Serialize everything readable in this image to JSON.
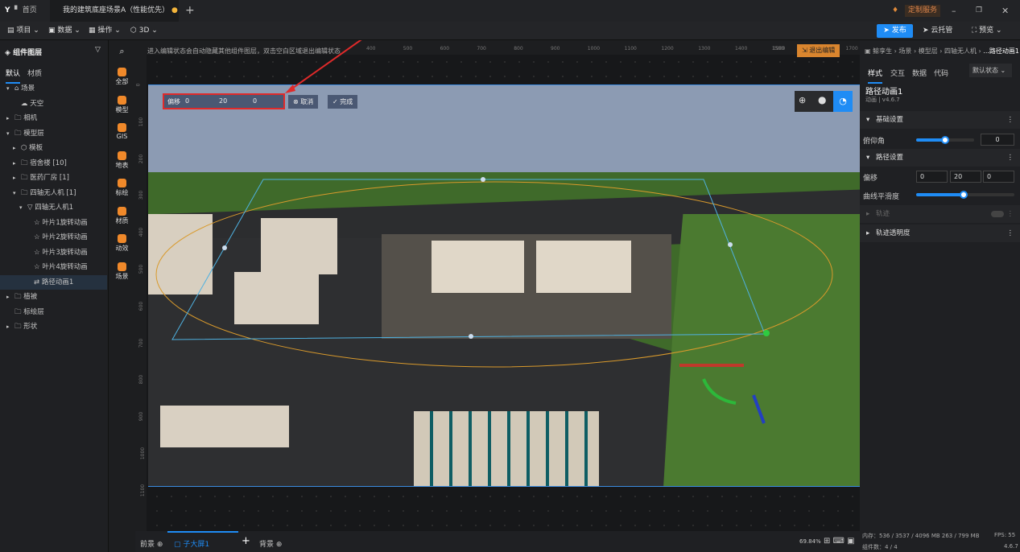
{
  "tabs": {
    "logo": "Y",
    "home": "首页",
    "active": "我的建筑底座场景A（性能优先）",
    "add": "+",
    "custom_service": "定制服务"
  },
  "toolbar": {
    "project": "项目",
    "data": "数据",
    "ops": "操作",
    "three_d": "3D",
    "publish": "发布",
    "cloud": "云托管",
    "preview": "预览"
  },
  "layers": {
    "title": "组件图层",
    "tabs": [
      "默认",
      "材质"
    ],
    "items": [
      {
        "label": "场景"
      },
      {
        "label": "天空"
      },
      {
        "label": "相机"
      },
      {
        "label": "模型层"
      },
      {
        "label": "模板"
      },
      {
        "label": "宿舍楼 [10]"
      },
      {
        "label": "医药厂房 [1]"
      },
      {
        "label": "四轴无人机 [1]"
      },
      {
        "label": "四轴无人机1"
      },
      {
        "label": "叶片1旋转动画"
      },
      {
        "label": "叶片2旋转动画"
      },
      {
        "label": "叶片3旋转动画"
      },
      {
        "label": "叶片4旋转动画"
      },
      {
        "label": "路径动画1"
      },
      {
        "label": "植被"
      },
      {
        "label": "标绘层"
      },
      {
        "label": "形状"
      }
    ]
  },
  "categories": [
    "全部",
    "模型",
    "GIS",
    "地表",
    "标绘",
    "材质",
    "动效",
    "场景"
  ],
  "canvas": {
    "hint": "进入编辑状态会自动隐藏其他组件图层，双击空白区域退出编辑状态",
    "exit_edit": "退出编辑",
    "ruler_top": [
      "400",
      "500",
      "600",
      "700",
      "800",
      "900",
      "1000",
      "1100",
      "1200",
      "1300",
      "1400",
      "1500",
      "1600",
      "1700",
      "1900"
    ],
    "ruler_left": [
      "0",
      "100",
      "200",
      "300",
      "400",
      "500",
      "600",
      "700",
      "800",
      "900",
      "1000",
      "1100"
    ],
    "offset_label": "偏移",
    "offset": [
      "0",
      "20",
      "0"
    ],
    "cancel": "取消",
    "done": "完成"
  },
  "right": {
    "breadcrumb": [
      "鲸孪生",
      "场景",
      "模型层",
      "四轴无人机",
      "...路径动画1"
    ],
    "tabs": [
      "样式",
      "交互",
      "数据",
      "代码"
    ],
    "state": "默认状态",
    "name": "路径动画1",
    "version": "动画 | v4.6.7",
    "basic": "基础设置",
    "pitch_label": "俯仰角",
    "pitch_value": "0",
    "pitch_level": 0.5,
    "path": "路径设置",
    "offset_label": "偏移",
    "offset": [
      "0",
      "20",
      "0"
    ],
    "smooth_label": "曲线平滑度",
    "smooth_level": 0.48,
    "track": "轨迹",
    "track_opacity": "轨迹透明度"
  },
  "bottom": {
    "front": "前景",
    "screen": "子大屏1",
    "back": "背景",
    "zoom": "69.84%",
    "memory": "内存：536 / 3537 / 4096 MB 263 / 799 MB",
    "fps": "FPS: 55",
    "count": "组件数：4 / 4",
    "version": "4.6.7"
  },
  "colors": {
    "accent": "#1f8cf5",
    "orange": "#f0892a",
    "highlight": "#e02a2a"
  }
}
